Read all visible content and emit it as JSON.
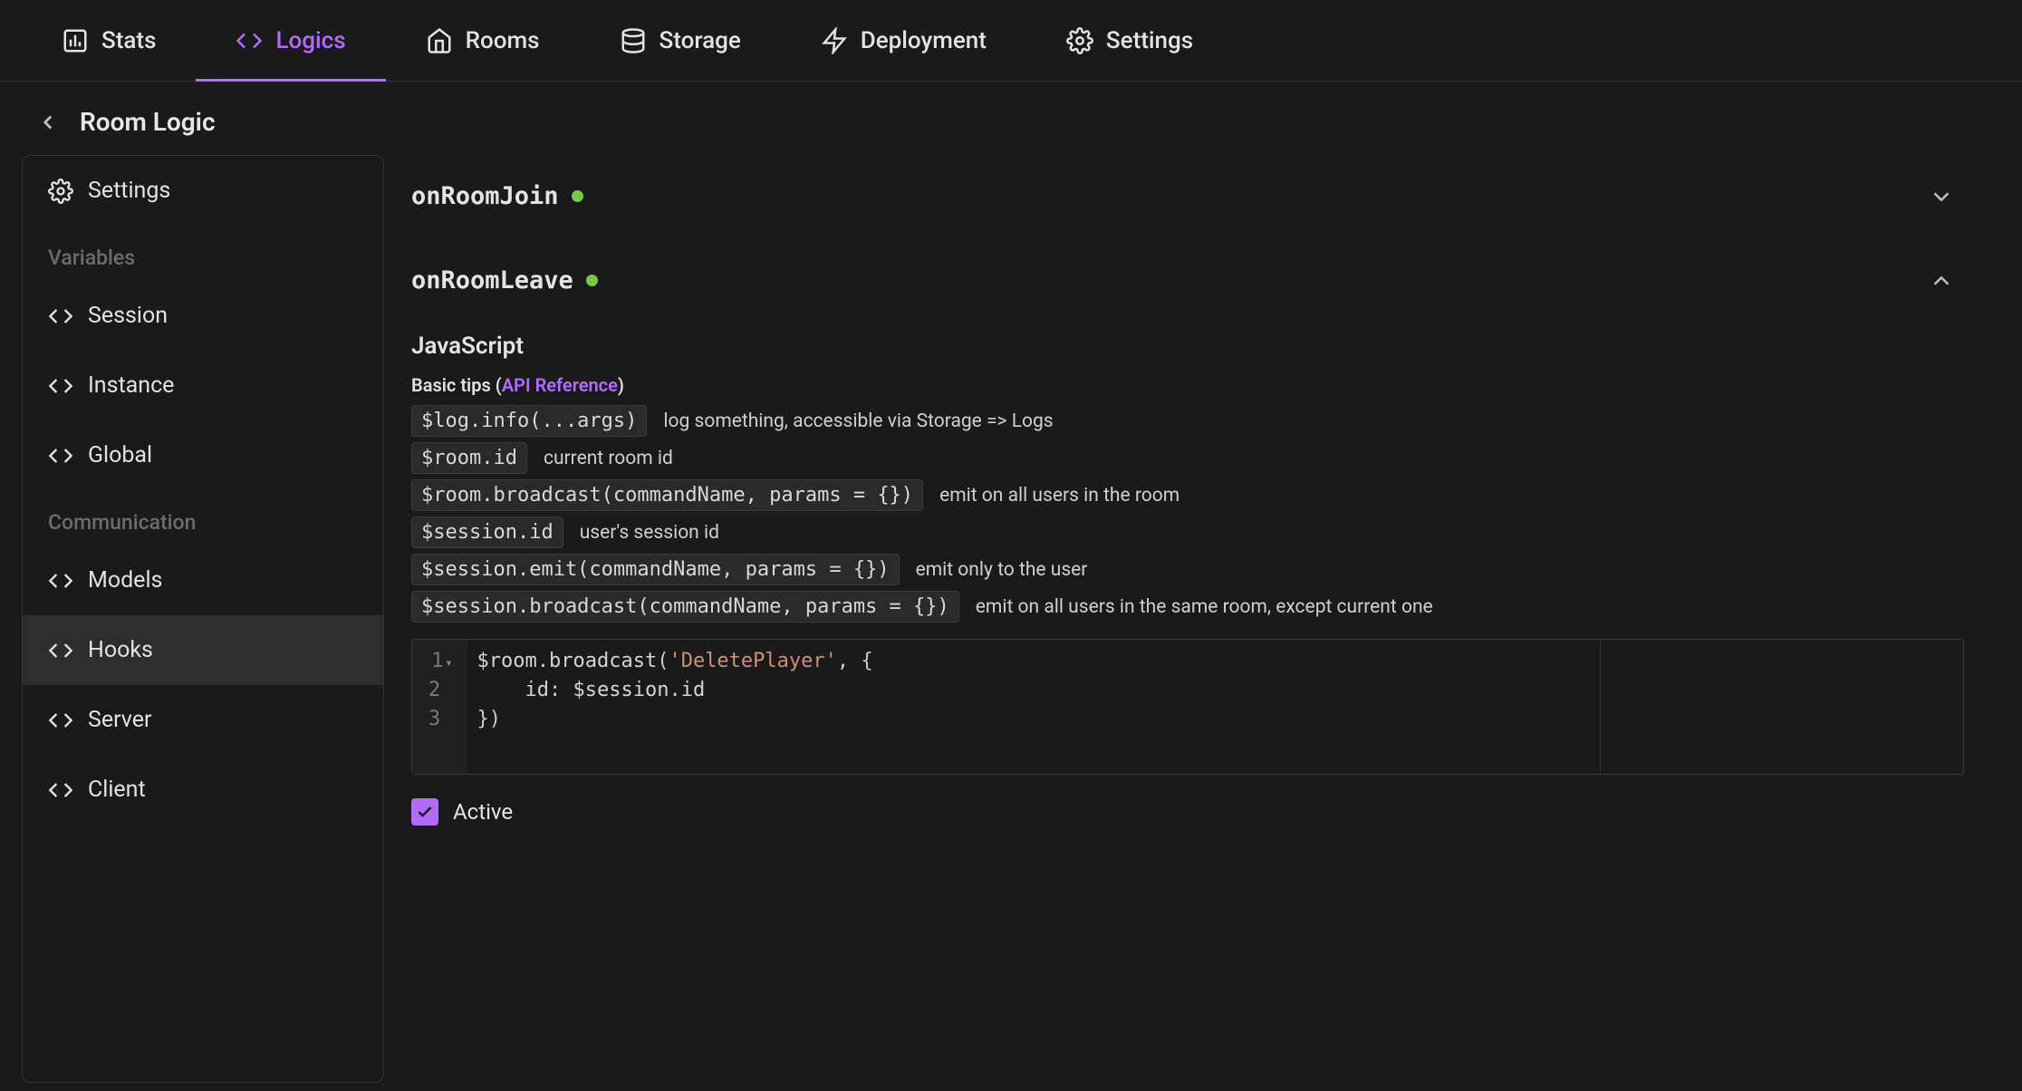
{
  "tabs": [
    {
      "id": "stats",
      "label": "Stats",
      "icon": "bar-chart-icon"
    },
    {
      "id": "logics",
      "label": "Logics",
      "icon": "code-icon",
      "active": true
    },
    {
      "id": "rooms",
      "label": "Rooms",
      "icon": "home-icon"
    },
    {
      "id": "storage",
      "label": "Storage",
      "icon": "db-icon"
    },
    {
      "id": "deployment",
      "label": "Deployment",
      "icon": "bolt-icon"
    },
    {
      "id": "settings",
      "label": "Settings",
      "icon": "gear-icon"
    }
  ],
  "page_title": "Room Logic",
  "sidebar": {
    "settings_label": "Settings",
    "section_variables": "Variables",
    "items_vars": [
      {
        "id": "session",
        "label": "Session"
      },
      {
        "id": "instance",
        "label": "Instance"
      },
      {
        "id": "global",
        "label": "Global"
      }
    ],
    "section_comm": "Communication",
    "items_comm": [
      {
        "id": "models",
        "label": "Models"
      },
      {
        "id": "hooks",
        "label": "Hooks",
        "selected": true
      },
      {
        "id": "server",
        "label": "Server"
      },
      {
        "id": "client",
        "label": "Client"
      }
    ]
  },
  "hooks": {
    "onRoomJoin": {
      "title": "onRoomJoin",
      "expanded": false,
      "active": true
    },
    "onRoomLeave": {
      "title": "onRoomLeave",
      "expanded": true,
      "active": true
    }
  },
  "editor": {
    "lang_label": "JavaScript",
    "tips_prefix": "Basic tips (",
    "tips_link": "API Reference",
    "tips_suffix": ")",
    "tips": [
      {
        "code": "$log.info(...args)",
        "desc": "log something, accessible via Storage => Logs"
      },
      {
        "code": "$room.id",
        "desc": "current room id"
      },
      {
        "code": "$room.broadcast(commandName, params = {})",
        "desc": "emit on all users in the room"
      },
      {
        "code": "$session.id",
        "desc": "user's session id"
      },
      {
        "code": "$session.emit(commandName, params = {})",
        "desc": "emit only to the user"
      },
      {
        "code": "$session.broadcast(commandName, params = {})",
        "desc": "emit on all users in the same room, except current one"
      }
    ],
    "code_lines": [
      "$room.broadcast('DeletePlayer', {",
      "    id: $session.id",
      "})"
    ],
    "active_label": "Active",
    "active_checked": true
  }
}
